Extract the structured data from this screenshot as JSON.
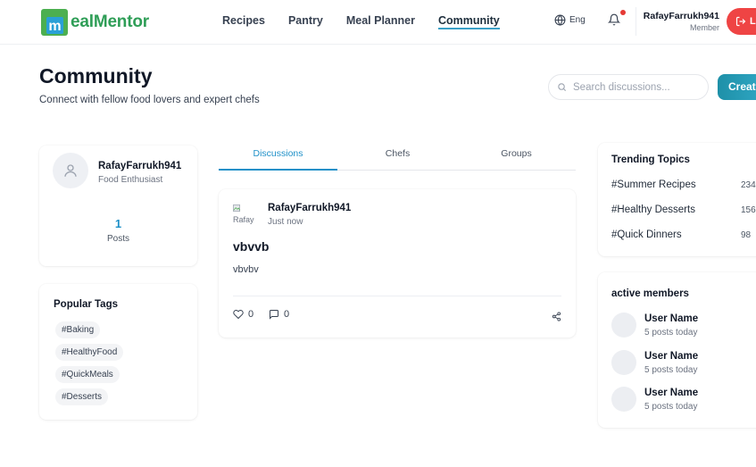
{
  "brand": {
    "name": "ealMentor",
    "logo_letter": "m"
  },
  "nav": [
    {
      "label": "Recipes"
    },
    {
      "label": "Pantry"
    },
    {
      "label": "Meal Planner"
    },
    {
      "label": "Community",
      "active": true
    }
  ],
  "header": {
    "language": "Eng",
    "notification_dot": true,
    "user": {
      "name": "RafayFarrukh941",
      "role": "Member"
    },
    "logout_label": "L"
  },
  "page": {
    "title": "Community",
    "subtitle": "Connect with fellow food lovers and expert chefs",
    "search_placeholder": "Search discussions...",
    "create_label": "Creat"
  },
  "profile": {
    "name": "RafayFarrukh941",
    "role": "Food Enthusiast",
    "posts_count": "1",
    "posts_label": "Posts"
  },
  "popular_tags": {
    "title": "Popular Tags",
    "tags": [
      "#Baking",
      "#HealthyFood",
      "#QuickMeals",
      "#Desserts"
    ]
  },
  "tabs": [
    {
      "label": "Discussions",
      "active": true
    },
    {
      "label": "Chefs"
    },
    {
      "label": "Groups"
    }
  ],
  "post": {
    "avatar_alt": "Rafay",
    "author": "RafayFarrukh941",
    "time": "Just now",
    "title": "vbvvb",
    "body": "vbvbv",
    "likes": "0",
    "comments": "0"
  },
  "trending": {
    "title": "Trending Topics",
    "items": [
      {
        "topic": "#Summer Recipes",
        "count": "234"
      },
      {
        "topic": "#Healthy Desserts",
        "count": "156"
      },
      {
        "topic": "#Quick Dinners",
        "count": "98"
      }
    ]
  },
  "members": {
    "title": "active members",
    "items": [
      {
        "name": "User Name",
        "stat": "5 posts today"
      },
      {
        "name": "User Name",
        "stat": "5 posts today"
      },
      {
        "name": "User Name",
        "stat": "5 posts today"
      }
    ]
  },
  "colors": {
    "brand_green": "#2f9e57",
    "brand_blue": "#1e90c8",
    "accent_red": "#ef4444"
  }
}
